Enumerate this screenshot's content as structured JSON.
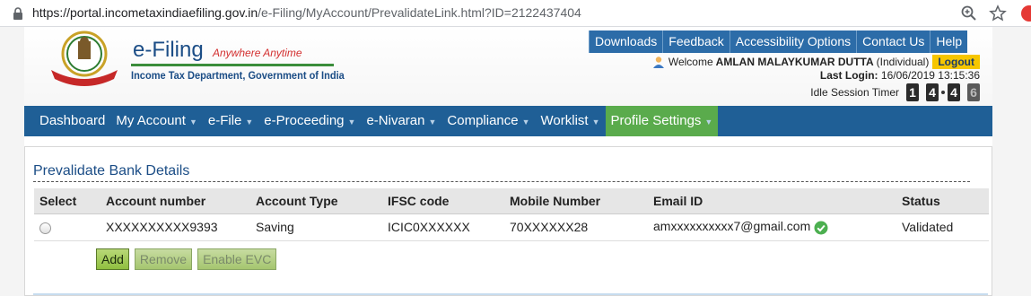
{
  "browser": {
    "url_host": "https://portal.incometaxindiaefiling.gov.in",
    "url_path": "/e-Filing/MyAccount/PrevalidateLink.html?ID=2122437404"
  },
  "header": {
    "brand_title": "e-Filing",
    "tagline": "Anywhere Anytime",
    "department": "Income Tax Department, Government of India",
    "emblem_text": "INCOME TAX DEPARTMENT",
    "top_links": [
      "Downloads",
      "Feedback",
      "Accessibility Options",
      "Contact Us",
      "Help"
    ],
    "welcome_prefix": "Welcome",
    "user_name": "AMLAN MALAYKUMAR DUTTA",
    "user_type": "(Individual)",
    "logout_label": "Logout",
    "last_login_label": "Last Login:",
    "last_login_value": "16/06/2019 13:15:36",
    "idle_label": "Idle Session Timer",
    "timer_digits": [
      "1",
      "4",
      "4",
      "6"
    ]
  },
  "mainnav": {
    "items": [
      {
        "label": "Dashboard",
        "caret": ""
      },
      {
        "label": "My Account",
        "caret": "▼"
      },
      {
        "label": "e-File",
        "caret": "▼"
      },
      {
        "label": "e-Proceeding",
        "caret": "▼"
      },
      {
        "label": "e-Nivaran",
        "caret": "▼"
      },
      {
        "label": "Compliance",
        "caret": "▼"
      },
      {
        "label": "Worklist",
        "caret": "▼"
      },
      {
        "label": "Profile Settings",
        "caret": "▼"
      }
    ]
  },
  "section": {
    "title": "Prevalidate Bank Details",
    "columns": [
      "Select",
      "Account number",
      "Account Type",
      "IFSC code",
      "Mobile Number",
      "Email ID",
      "Status"
    ],
    "rows": [
      {
        "account": "XXXXXXXXXX9393",
        "type": "Saving",
        "ifsc": "ICIC0XXXXXX",
        "mobile": "70XXXXXX28",
        "email": "amxxxxxxxxxx7@gmail.com",
        "status": "Validated"
      }
    ],
    "buttons": {
      "add": "Add",
      "remove": "Remove",
      "enable_evc": "Enable EVC"
    }
  },
  "colors": {
    "nav_bg": "#1f5f96",
    "active_nav": "#5aab4c",
    "logout_bg": "#f6c600",
    "button_green": "#8fbf3f"
  }
}
